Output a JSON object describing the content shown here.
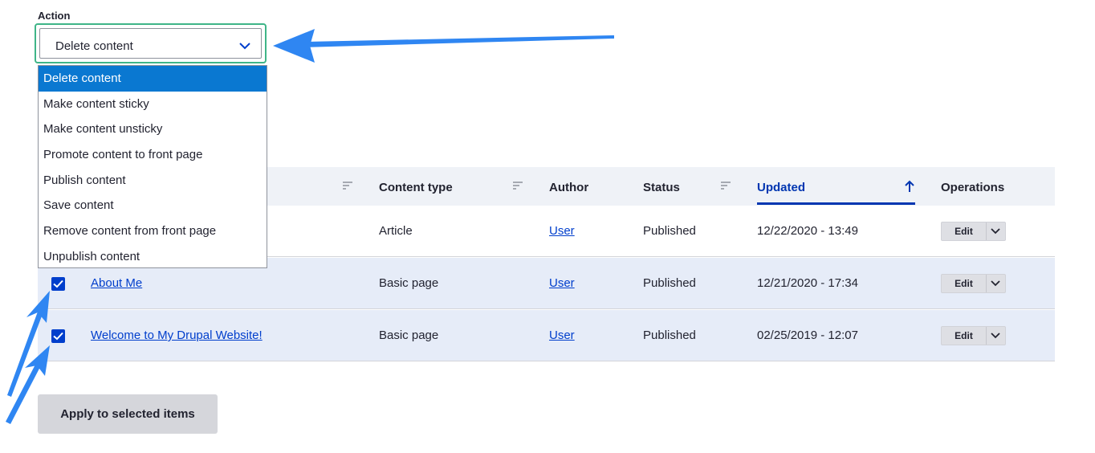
{
  "action": {
    "label": "Action",
    "selected": "Delete content",
    "options": [
      "Delete content",
      "Make content sticky",
      "Make content unsticky",
      "Promote content to front page",
      "Publish content",
      "Save content",
      "Remove content from front page",
      "Unpublish content"
    ],
    "highlighted_index": 0
  },
  "table": {
    "headers": {
      "content_type": "Content type",
      "author": "Author",
      "status": "Status",
      "updated": "Updated",
      "operations": "Operations"
    },
    "sorted_column": "Updated",
    "rows": [
      {
        "title": "",
        "type": "Article",
        "author": "User",
        "status": "Published",
        "updated": "12/22/2020 - 13:49",
        "checked": false,
        "operation": "Edit"
      },
      {
        "title": "About Me",
        "type": "Basic page",
        "author": "User",
        "status": "Published",
        "updated": "12/21/2020 - 17:34",
        "checked": true,
        "operation": "Edit"
      },
      {
        "title": "Welcome to My Drupal Website!",
        "type": "Basic page",
        "author": "User",
        "status": "Published",
        "updated": "02/25/2019 - 12:07",
        "checked": true,
        "operation": "Edit"
      }
    ]
  },
  "apply_button": "Apply to selected items",
  "colors": {
    "focus_border": "#3fb588",
    "selected_option": "#0a78d1",
    "link": "#003ecc",
    "annotation_arrow": "#2f86f2"
  }
}
